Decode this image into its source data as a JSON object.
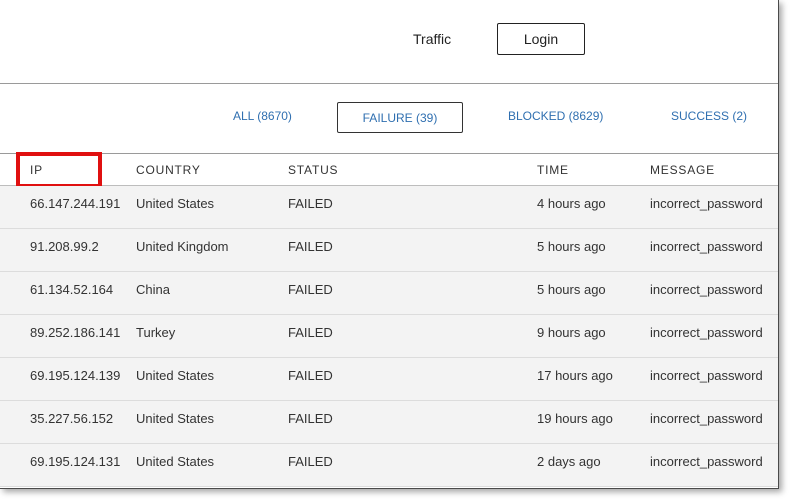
{
  "header": {
    "nav_traffic": "Traffic",
    "login_label": "Login"
  },
  "filters": [
    {
      "label": "ALL (8670)",
      "active": false
    },
    {
      "label": "FAILURE (39)",
      "active": true
    },
    {
      "label": "BLOCKED (8629)",
      "active": false
    },
    {
      "label": "SUCCESS (2)",
      "active": false
    }
  ],
  "table": {
    "columns": [
      "IP",
      "COUNTRY",
      "STATUS",
      "TIME",
      "MESSAGE"
    ],
    "rows": [
      {
        "ip": "66.147.244.191",
        "country": "United States",
        "status": "FAILED",
        "time": "4 hours ago",
        "message": "incorrect_password"
      },
      {
        "ip": "91.208.99.2",
        "country": "United Kingdom",
        "status": "FAILED",
        "time": "5 hours ago",
        "message": "incorrect_password"
      },
      {
        "ip": "61.134.52.164",
        "country": "China",
        "status": "FAILED",
        "time": "5 hours ago",
        "message": "incorrect_password"
      },
      {
        "ip": "89.252.186.141",
        "country": "Turkey",
        "status": "FAILED",
        "time": "9 hours ago",
        "message": "incorrect_password"
      },
      {
        "ip": "69.195.124.139",
        "country": "United States",
        "status": "FAILED",
        "time": "17 hours ago",
        "message": "incorrect_password"
      },
      {
        "ip": "35.227.56.152",
        "country": "United States",
        "status": "FAILED",
        "time": "19 hours ago",
        "message": "incorrect_password"
      },
      {
        "ip": "69.195.124.131",
        "country": "United States",
        "status": "FAILED",
        "time": "2 days ago",
        "message": "incorrect_password"
      }
    ]
  },
  "colors": {
    "link": "#2f6fb0",
    "highlight": "#e01010",
    "row_bg": "#f3f3f3"
  }
}
